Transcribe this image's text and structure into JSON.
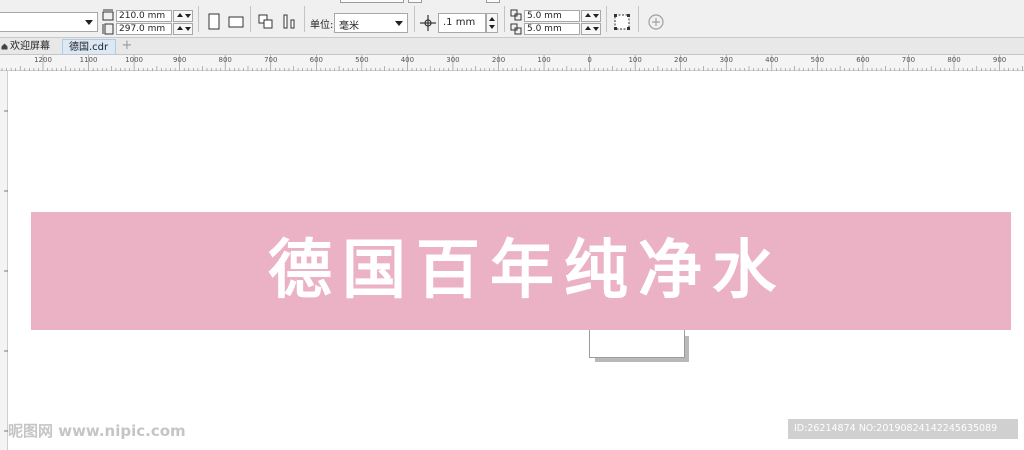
{
  "property_bar": {
    "paper_size_value": "",
    "width_value": "210.0 mm",
    "height_value": "297.0 mm",
    "units_label": "单位:",
    "units_value": "毫米",
    "nudge_value": ".1 mm",
    "dup_x_value": "5.0 mm",
    "dup_y_value": "5.0 mm",
    "icons": [
      "width-icon",
      "height-icon",
      "portrait-icon",
      "landscape-icon",
      "all-pages-icon",
      "current-page-icon",
      "nudge-icon",
      "duplicate-x-icon",
      "duplicate-y-icon",
      "treat-as-filled-icon",
      "add-icon"
    ]
  },
  "tabs": {
    "home": "欢迎屏幕",
    "document": "德国.cdr",
    "add": "+"
  },
  "ruler": {
    "labels": [
      "1200",
      "1100",
      "1000",
      "900",
      "800",
      "700",
      "600",
      "500",
      "400",
      "300",
      "200",
      "100",
      "0",
      "100",
      "200",
      "300",
      "400",
      "500",
      "600",
      "700",
      "800",
      "900"
    ]
  },
  "canvas": {
    "banner_text": "德国百年纯净水",
    "banner_color": "#ebb1c4"
  },
  "watermark": {
    "left": "昵图网 www.nipic.com",
    "right": "ID:26214874 NO:20190824142245635089"
  }
}
